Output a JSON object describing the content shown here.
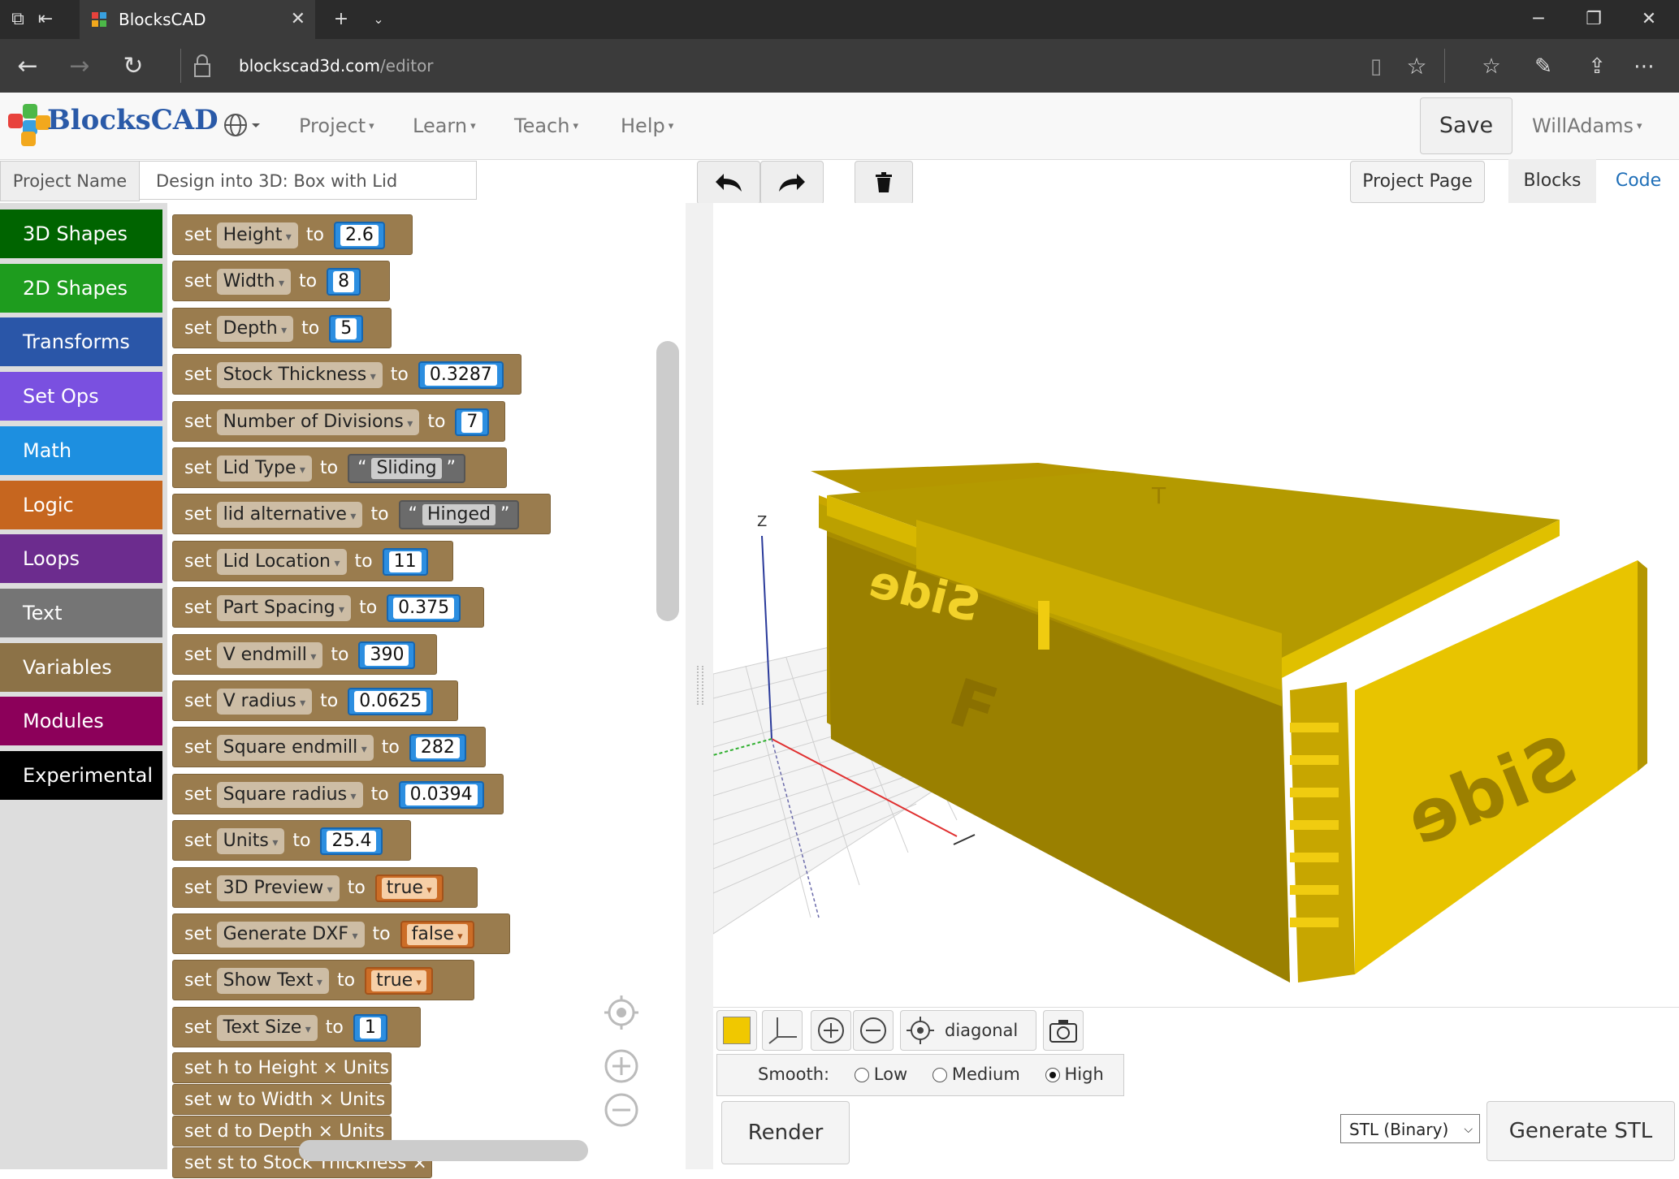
{
  "browser": {
    "tab_title": "BlocksCAD",
    "url_host": "blockscad3d.com",
    "url_path": "/editor"
  },
  "header": {
    "logo": "BlocksCAD",
    "menus": [
      "Project",
      "Learn",
      "Teach",
      "Help"
    ],
    "save_label": "Save",
    "user_label": "WillAdams"
  },
  "project": {
    "label": "Project Name",
    "name": "Design into 3D: Box with Lid",
    "project_page_label": "Project Page",
    "tab_blocks": "Blocks",
    "tab_code": "Code"
  },
  "categories": [
    {
      "label": "3D Shapes",
      "color": "#006400"
    },
    {
      "label": "2D Shapes",
      "color": "#1e9c1e"
    },
    {
      "label": "Transforms",
      "color": "#2a56a8"
    },
    {
      "label": "Set Ops",
      "color": "#7a50e0"
    },
    {
      "label": "Math",
      "color": "#1d8fe0"
    },
    {
      "label": "Logic",
      "color": "#c6661f"
    },
    {
      "label": "Loops",
      "color": "#6c2c8e"
    },
    {
      "label": "Text",
      "color": "#757575"
    },
    {
      "label": "Variables",
      "color": "#8c7247"
    },
    {
      "label": "Modules",
      "color": "#8c005a"
    },
    {
      "label": "Experimental",
      "color": "#000000"
    }
  ],
  "blocks": {
    "set_word": "set",
    "to_word": "to",
    "items": [
      {
        "var": "Height",
        "value": "2.6",
        "kind": "num"
      },
      {
        "var": "Width",
        "value": "8",
        "kind": "num"
      },
      {
        "var": "Depth",
        "value": "5",
        "kind": "num"
      },
      {
        "var": "Stock Thickness",
        "value": "0.3287",
        "kind": "num"
      },
      {
        "var": "Number of Divisions",
        "value": "7",
        "kind": "num"
      },
      {
        "var": "Lid Type",
        "value": "Sliding",
        "kind": "str"
      },
      {
        "var": "lid alternative",
        "value": "Hinged",
        "kind": "str"
      },
      {
        "var": "Lid Location",
        "value": "11",
        "kind": "num"
      },
      {
        "var": "Part Spacing",
        "value": "0.375",
        "kind": "num"
      },
      {
        "var": "V endmill",
        "value": "390",
        "kind": "num"
      },
      {
        "var": "V radius",
        "value": "0.0625",
        "kind": "num"
      },
      {
        "var": "Square endmill",
        "value": "282",
        "kind": "num"
      },
      {
        "var": "Square radius",
        "value": "0.0394",
        "kind": "num"
      },
      {
        "var": "Units",
        "value": "25.4",
        "kind": "num"
      },
      {
        "var": "3D Preview",
        "value": "true",
        "kind": "bool"
      },
      {
        "var": "Generate DXF",
        "value": "false",
        "kind": "bool"
      },
      {
        "var": "Show Text",
        "value": "true",
        "kind": "bool"
      },
      {
        "var": "Text Size",
        "value": "1",
        "kind": "num"
      }
    ],
    "collapsed": [
      "set h to Height × Units",
      "set w to Width × Units",
      "set d to Depth × Units",
      "set st to Stock Thickness × ..."
    ]
  },
  "viewer": {
    "view_label": "diagonal",
    "smooth_label": "Smooth:",
    "smooth_options": [
      "Low",
      "Medium",
      "High"
    ],
    "smooth_selected": "High",
    "render_label": "Render",
    "export_format": "STL (Binary)",
    "generate_label": "Generate STL",
    "model_color": "#f0c800",
    "axis_z_label": "Z",
    "model_text": [
      "Side",
      "F",
      "Side",
      "T"
    ]
  }
}
